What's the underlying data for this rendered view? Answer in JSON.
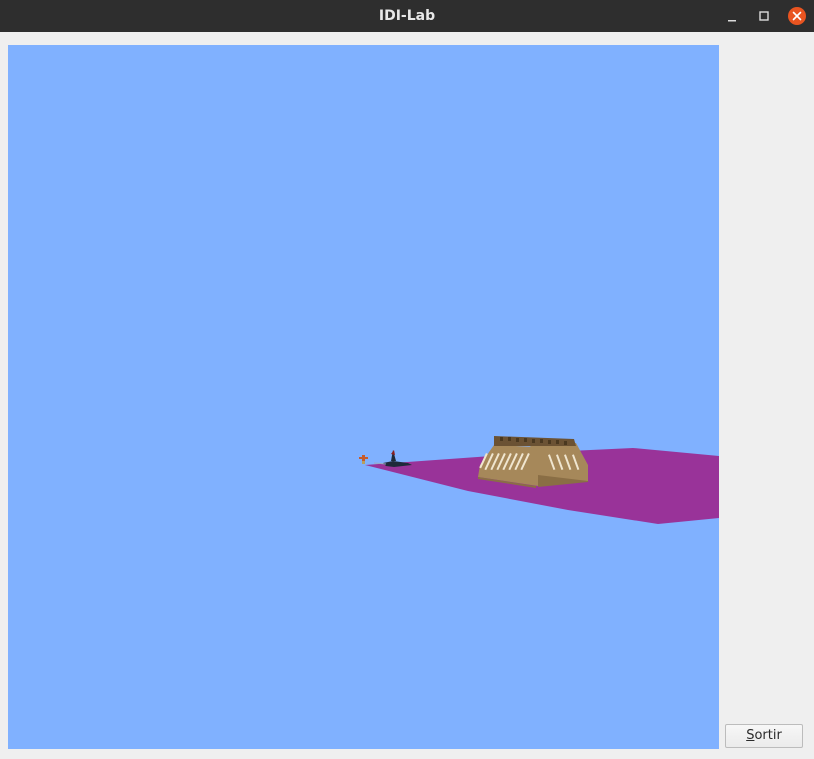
{
  "window": {
    "title": "IDI-Lab",
    "controls": {
      "minimize_icon": "minimize-icon",
      "maximize_icon": "maximize-icon",
      "close_icon": "close-icon",
      "close_color": "#e95420"
    }
  },
  "viewport": {
    "sky_color": "#80b1ff",
    "ground_color": "#993399",
    "building_color": "#a6885a",
    "scene": [
      "patricio-figure",
      "airplane-model",
      "building-model",
      "floor-plane"
    ]
  },
  "buttons": {
    "sortir_mnemonic": "S",
    "sortir_rest": "ortir"
  }
}
